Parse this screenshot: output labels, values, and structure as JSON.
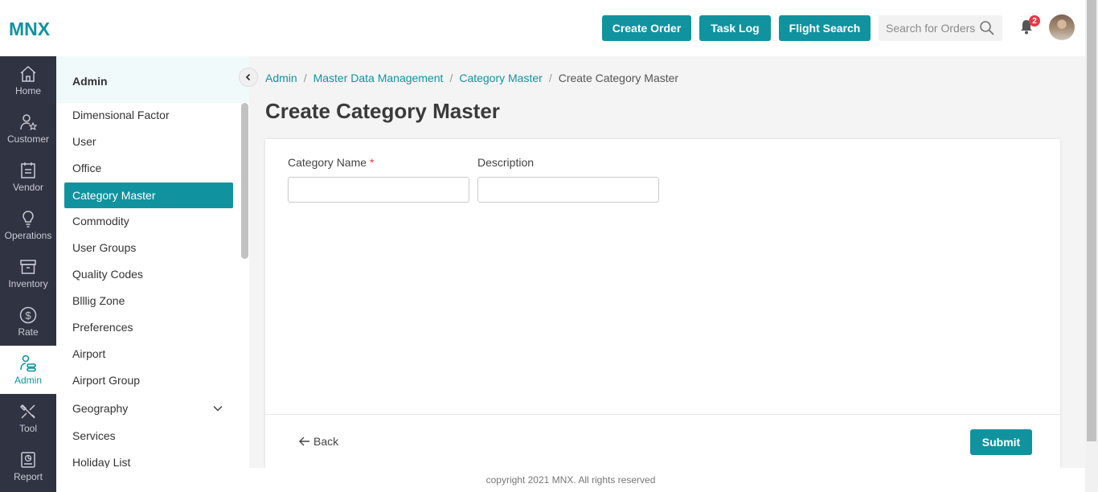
{
  "brand": {
    "logo": "MNX",
    "accent": "#10939f"
  },
  "header": {
    "buttons": [
      "Create Order",
      "Task Log",
      "Flight Search"
    ],
    "search_placeholder": "Search for Orders",
    "notification_count": "2"
  },
  "leftnav": {
    "items": [
      {
        "label": "Home",
        "icon": "home-icon"
      },
      {
        "label": "Customer",
        "icon": "customer-icon"
      },
      {
        "label": "Vendor",
        "icon": "vendor-icon"
      },
      {
        "label": "Operations",
        "icon": "operations-icon"
      },
      {
        "label": "Inventory",
        "icon": "inventory-icon"
      },
      {
        "label": "Rate",
        "icon": "rate-icon"
      },
      {
        "label": "Admin",
        "icon": "admin-icon"
      },
      {
        "label": "Tool",
        "icon": "tool-icon"
      },
      {
        "label": "Report",
        "icon": "report-icon"
      }
    ],
    "active": "Admin"
  },
  "subnav": {
    "title": "Admin",
    "items": [
      "Dimensional Factor",
      "User",
      "Office",
      "Category Master",
      "Commodity",
      "User Groups",
      "Quality Codes",
      "Blllig Zone",
      "Preferences",
      "Airport",
      "Airport Group",
      "Geography",
      "Services",
      "Holiday List"
    ],
    "active": "Category Master"
  },
  "breadcrumb": [
    "Admin",
    "Master Data Management",
    "Category Master",
    "Create Category Master"
  ],
  "page_title": "Create Category Master",
  "form": {
    "category_name_label": "Category Name",
    "required_mark": "*",
    "category_name_value": "",
    "description_label": "Description",
    "description_value": ""
  },
  "actions": {
    "back": "Back",
    "submit": "Submit"
  },
  "footer": "copyright 2021 MNX. All rights reserved"
}
